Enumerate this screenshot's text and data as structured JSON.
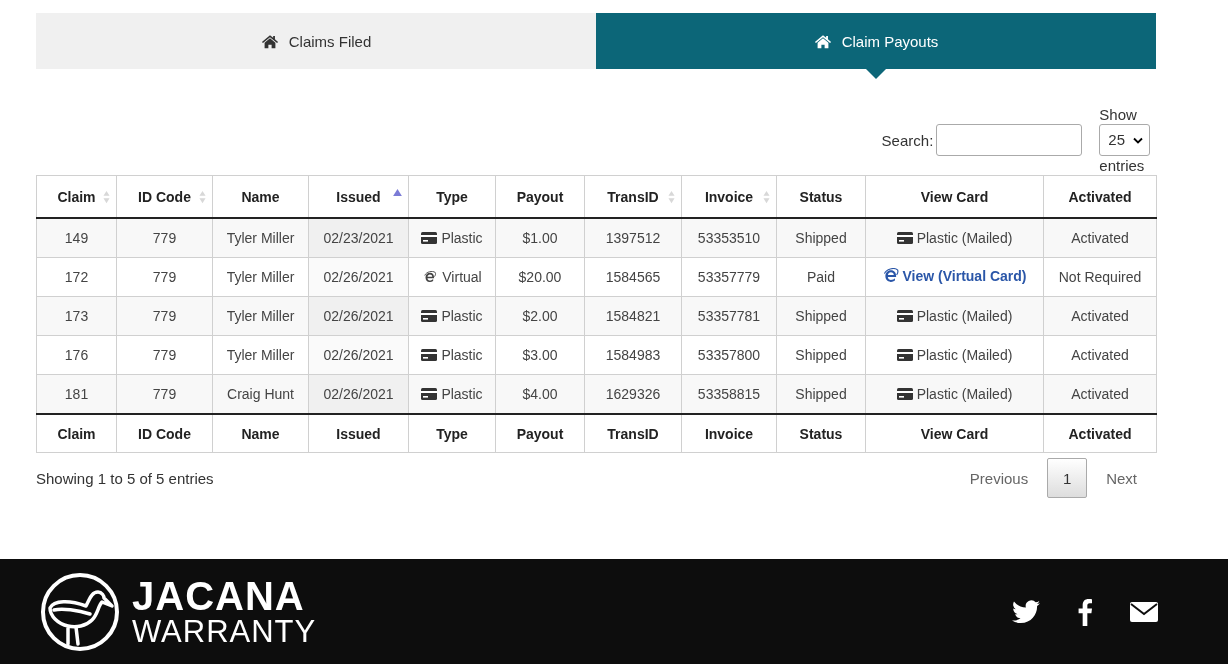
{
  "tabs": [
    {
      "label": "Claims Filed",
      "selected": false
    },
    {
      "label": "Claim Payouts",
      "selected": true
    }
  ],
  "search": {
    "label": "Search:"
  },
  "length": {
    "before": "Show",
    "value": "25",
    "after": "entries"
  },
  "table": {
    "columns": [
      {
        "label": "Claim",
        "sortable": true,
        "sorted_ascending": false
      },
      {
        "label": "ID Code",
        "sortable": true,
        "sorted_ascending": false
      },
      {
        "label": "Name",
        "sortable": false,
        "sorted_ascending": false
      },
      {
        "label": "Issued",
        "sortable": true,
        "sorted_ascending": true
      },
      {
        "label": "Type",
        "sortable": false,
        "sorted_ascending": false
      },
      {
        "label": "Payout",
        "sortable": false,
        "sorted_ascending": false
      },
      {
        "label": "TransID",
        "sortable": true,
        "sorted_ascending": false
      },
      {
        "label": "Invoice",
        "sortable": true,
        "sorted_ascending": false
      },
      {
        "label": "Status",
        "sortable": false,
        "sorted_ascending": false
      },
      {
        "label": "View Card",
        "sortable": false,
        "sorted_ascending": false
      },
      {
        "label": "Activated",
        "sortable": false,
        "sorted_ascending": false
      }
    ],
    "rows": [
      {
        "claim": "149",
        "id_code": "779",
        "name": "Tyler Miller",
        "issued": "02/23/2021",
        "type": {
          "kind": "plastic",
          "label": "Plastic"
        },
        "payout": "$1.00",
        "trans_id": "1397512",
        "invoice": "53353510",
        "status": "Shipped",
        "view_card": {
          "kind": "plastic",
          "label": "Plastic (Mailed)"
        },
        "activated": "Activated"
      },
      {
        "claim": "172",
        "id_code": "779",
        "name": "Tyler Miller",
        "issued": "02/26/2021",
        "type": {
          "kind": "virtual",
          "label": "Virtual"
        },
        "payout": "$20.00",
        "trans_id": "1584565",
        "invoice": "53357779",
        "status": "Paid",
        "view_card": {
          "kind": "virtual",
          "label": "View (Virtual Card)"
        },
        "activated": "Not Required"
      },
      {
        "claim": "173",
        "id_code": "779",
        "name": "Tyler Miller",
        "issued": "02/26/2021",
        "type": {
          "kind": "plastic",
          "label": "Plastic"
        },
        "payout": "$2.00",
        "trans_id": "1584821",
        "invoice": "53357781",
        "status": "Shipped",
        "view_card": {
          "kind": "plastic",
          "label": "Plastic (Mailed)"
        },
        "activated": "Activated"
      },
      {
        "claim": "176",
        "id_code": "779",
        "name": "Tyler Miller",
        "issued": "02/26/2021",
        "type": {
          "kind": "plastic",
          "label": "Plastic"
        },
        "payout": "$3.00",
        "trans_id": "1584983",
        "invoice": "53357800",
        "status": "Shipped",
        "view_card": {
          "kind": "plastic",
          "label": "Plastic (Mailed)"
        },
        "activated": "Activated"
      },
      {
        "claim": "181",
        "id_code": "779",
        "name": "Craig Hunt",
        "issued": "02/26/2021",
        "type": {
          "kind": "plastic",
          "label": "Plastic"
        },
        "payout": "$4.00",
        "trans_id": "1629326",
        "invoice": "53358815",
        "status": "Shipped",
        "view_card": {
          "kind": "plastic",
          "label": "Plastic (Mailed)"
        },
        "activated": "Activated"
      }
    ],
    "footer_columns": [
      "Claim",
      "ID Code",
      "Name",
      "Issued",
      "Type",
      "Payout",
      "TransID",
      "Invoice",
      "Status",
      "View Card",
      "Activated"
    ]
  },
  "info": "Showing 1 to 5 of 5 entries",
  "pagination": {
    "previous": "Previous",
    "pages": [
      {
        "label": "1",
        "selected": true
      }
    ],
    "next": "Next"
  },
  "footer": {
    "logo_top": "JACANA",
    "logo_bottom": "WARRANTY"
  }
}
